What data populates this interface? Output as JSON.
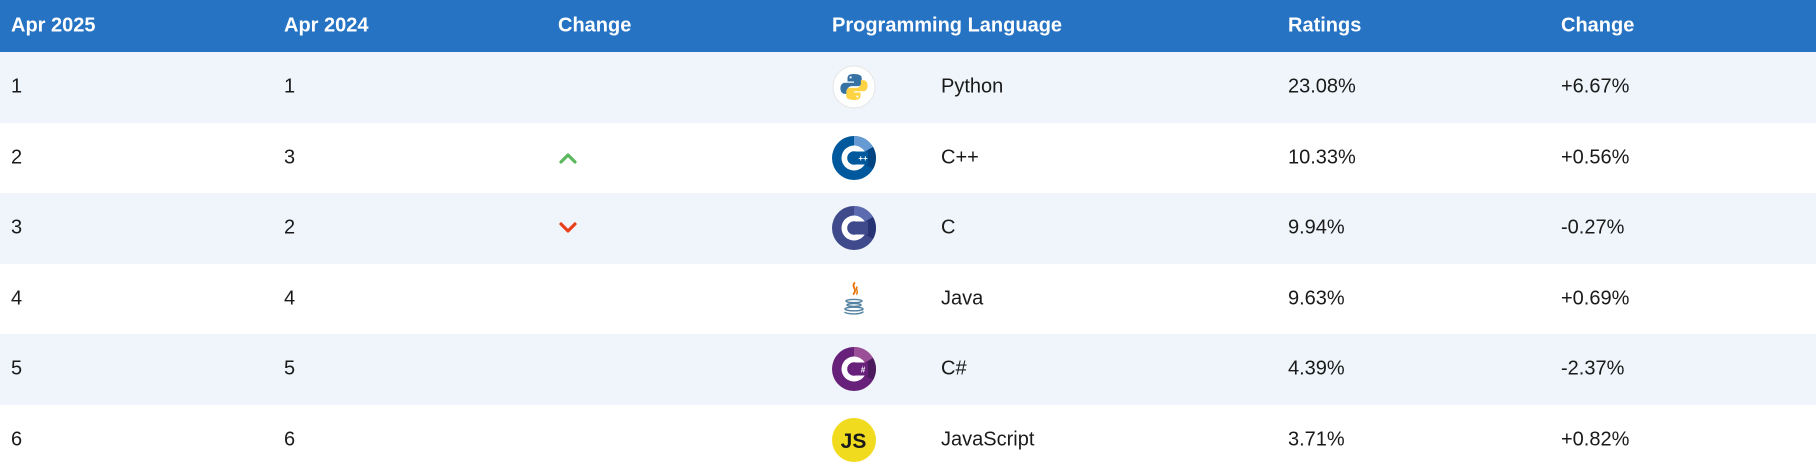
{
  "headers": {
    "current": "Apr 2025",
    "previous": "Apr 2024",
    "change": "Change",
    "language": "Programming Language",
    "ratings": "Ratings",
    "rating_change": "Change"
  },
  "colors": {
    "header_bg": "#2673c3",
    "row_alt_bg": "#eff5fa",
    "up_arrow": "#5cb85c",
    "down_arrow": "#e8401c"
  },
  "rows": [
    {
      "current": "1",
      "previous": "1",
      "trend": "none",
      "icon": "python-logo-icon",
      "language": "Python",
      "rating": "23.08%",
      "change": "+6.67%"
    },
    {
      "current": "2",
      "previous": "3",
      "trend": "up",
      "icon": "cpp-logo-icon",
      "language": "C++",
      "rating": "10.33%",
      "change": "+0.56%"
    },
    {
      "current": "3",
      "previous": "2",
      "trend": "down",
      "icon": "c-logo-icon",
      "language": "C",
      "rating": "9.94%",
      "change": "-0.27%"
    },
    {
      "current": "4",
      "previous": "4",
      "trend": "none",
      "icon": "java-logo-icon",
      "language": "Java",
      "rating": "9.63%",
      "change": "+0.69%"
    },
    {
      "current": "5",
      "previous": "5",
      "trend": "none",
      "icon": "csharp-logo-icon",
      "language": "C#",
      "rating": "4.39%",
      "change": "-2.37%"
    },
    {
      "current": "6",
      "previous": "6",
      "trend": "none",
      "icon": "javascript-logo-icon",
      "language": "JavaScript",
      "rating": "3.71%",
      "change": "+0.82%"
    }
  ]
}
